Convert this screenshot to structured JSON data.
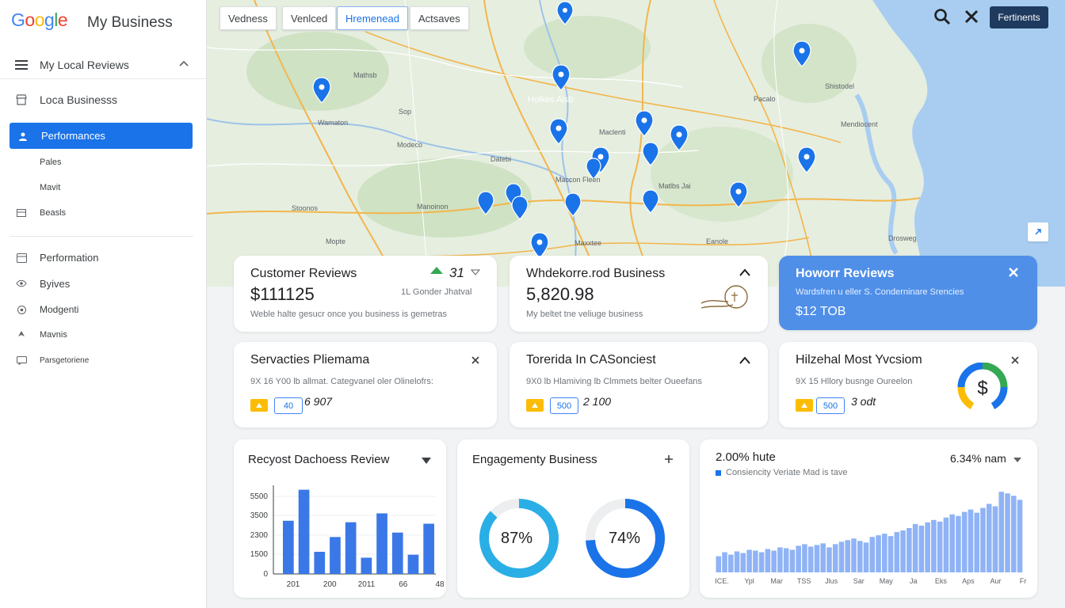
{
  "brand": {
    "logo_text": "Google",
    "product": "My Business"
  },
  "sidebar": {
    "header": "My Local Reviews",
    "items": [
      {
        "label": "Loca Businesss",
        "icon": "storefront-icon"
      },
      {
        "label": "Performances",
        "icon": "person-icon",
        "active": true
      },
      {
        "label": "Pales",
        "icon": ""
      },
      {
        "label": "Mavit",
        "icon": ""
      },
      {
        "label": "Beasls",
        "icon": "list-icon"
      },
      {
        "label": "Performation",
        "icon": "calendar-icon"
      },
      {
        "label": "Byives",
        "icon": "eye-icon"
      },
      {
        "label": "Modgenti",
        "icon": "settings-icon"
      },
      {
        "label": "Mavnis",
        "icon": "arrow-icon"
      },
      {
        "label": "Parsgetoriene",
        "icon": "chat-icon"
      }
    ]
  },
  "map": {
    "chips": [
      "Vedness",
      "Venlced",
      "Hremenead",
      "Actsaves"
    ],
    "action_button": "Fertinents",
    "labels": [
      "Mathsb",
      "Sop",
      "Holkes Aisb",
      "Modeco",
      "Wamaton",
      "Datebi",
      "Maccon Fleen",
      "Maclenti",
      "Manoinon",
      "Stoonos",
      "Matlbs Jai",
      "Maxxtee",
      "Shistodel",
      "Mendiocent",
      "Pacalo",
      "Eanole",
      "Mopte",
      "Drosweg"
    ]
  },
  "cards": {
    "customer_reviews": {
      "title": "Customer Reviews",
      "value": "$111125",
      "stat": "31",
      "stat_sub": "1L Gonder Jhatval",
      "note": "Weble halte gesucr once you business is gemetras"
    },
    "business": {
      "title": "Whdekorre.rod Business",
      "value": "5,820.98",
      "note": "My beltet tne veliuge business"
    },
    "hour_reviews": {
      "title": "Howorr Reviews",
      "sub": "Wardsfren u eller S. Conderninare Srencies",
      "value": "$12 TOB"
    },
    "servacties": {
      "title": "Servacties Pliemama",
      "sub": "9X 16 Y00 lb allmat. Categvanel oler Olinelofrs:",
      "badge": "40",
      "stat": "6 907"
    },
    "torerida": {
      "title": "Torerida In CASonciest",
      "sub": "9X0 lb Hlamiving lb Clmmets belter Oueefans",
      "badge": "500",
      "stat": "2 100"
    },
    "hilzehal": {
      "title": "Hilzehal Most Yvcsiom",
      "sub": "9X 15 Hllory busnge Oureelon",
      "badge": "500",
      "stat": "3 odt"
    },
    "recent_review": {
      "title": "Recyost Dachoess Review"
    },
    "engagement": {
      "title": "Engagementy Business"
    },
    "trend": {
      "headline": "2.00% hute",
      "right_value": "6.34% nam",
      "legend": "Consiencity Veriate Mad is tave"
    }
  },
  "chart_data": [
    {
      "type": "bar",
      "title": "Recyost Dachoess Review",
      "categories": [
        "201",
        "200",
        "2011",
        "66",
        "48"
      ],
      "yticks": [
        0,
        1500,
        2300,
        3500,
        5500
      ],
      "ylim": [
        0,
        6000
      ],
      "series": [
        {
          "values": [
            3600,
            5700,
            1500,
            2500,
            3500,
            1100,
            4100,
            2800,
            1300,
            3400
          ]
        }
      ],
      "grid": true
    },
    {
      "type": "pie",
      "title": "Engagementy Business",
      "slices": [
        {
          "label": "87%",
          "value": 87,
          "color": "#2aaee6"
        },
        {
          "label": "74%",
          "value": 74,
          "color": "#1a73e8"
        }
      ]
    },
    {
      "type": "bar",
      "title": "2.00% hute",
      "categories": [
        "ICE.",
        "Ypl",
        "Mar",
        "TSS",
        "Jlus",
        "Sar",
        "May",
        "Ja",
        "Eks",
        "Aps",
        "Aur",
        "Fr"
      ],
      "values": [
        20,
        25,
        22,
        26,
        24,
        28,
        27,
        25,
        29,
        27,
        31,
        30,
        28,
        33,
        35,
        32,
        34,
        36,
        31,
        35,
        38,
        40,
        42,
        39,
        37,
        44,
        46,
        48,
        45,
        50,
        52,
        55,
        60,
        58,
        62,
        65,
        63,
        68,
        72,
        70,
        75,
        78,
        74,
        80,
        85,
        82,
        100,
        98,
        95,
        90
      ],
      "ylim": [
        0,
        110
      ]
    }
  ]
}
